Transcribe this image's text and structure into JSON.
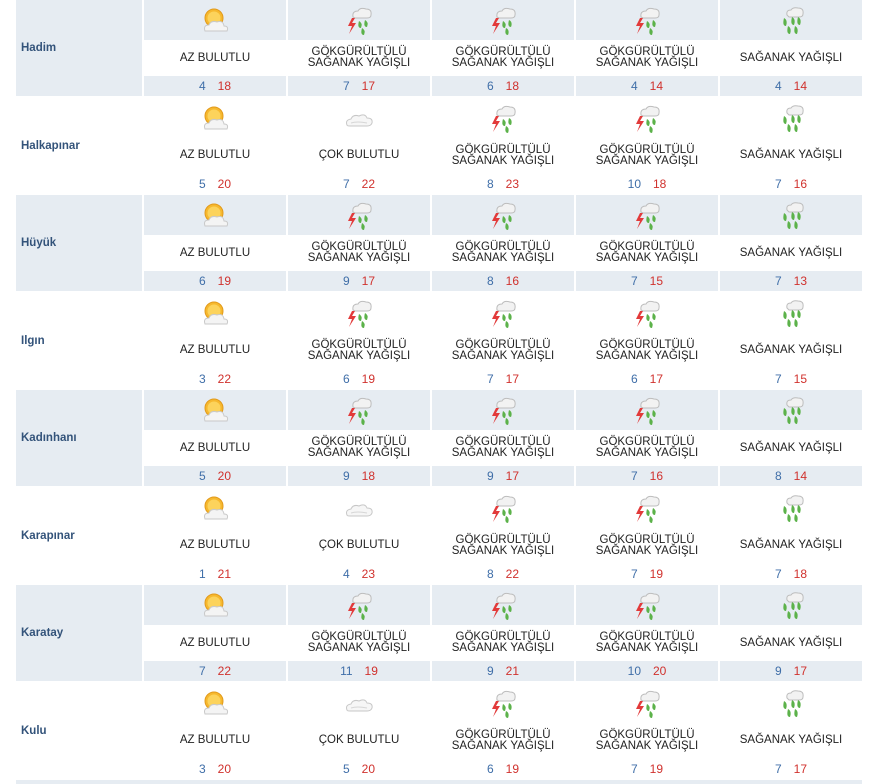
{
  "rows": [
    {
      "city": "Hadim",
      "days": [
        {
          "icon": "partly-cloudy-icon",
          "desc": "AZ BULUTLU",
          "min": "4",
          "max": "18"
        },
        {
          "icon": "thunder-rain-icon",
          "desc": "GÖKGÜRÜLTÜLÜ SAĞANAK YAĞIŞLI",
          "min": "7",
          "max": "17"
        },
        {
          "icon": "thunder-rain-icon",
          "desc": "GÖKGÜRÜLTÜLÜ SAĞANAK YAĞIŞLI",
          "min": "6",
          "max": "18"
        },
        {
          "icon": "thunder-rain-icon",
          "desc": "GÖKGÜRÜLTÜLÜ SAĞANAK YAĞIŞLI",
          "min": "4",
          "max": "14"
        },
        {
          "icon": "shower-rain-icon",
          "desc": "SAĞANAK YAĞIŞLI",
          "min": "4",
          "max": "14"
        }
      ]
    },
    {
      "city": "Halkapınar",
      "days": [
        {
          "icon": "partly-cloudy-icon",
          "desc": "AZ BULUTLU",
          "min": "5",
          "max": "20"
        },
        {
          "icon": "cloudy-icon",
          "desc": "ÇOK BULUTLU",
          "min": "7",
          "max": "22"
        },
        {
          "icon": "thunder-rain-icon",
          "desc": "GÖKGÜRÜLTÜLÜ SAĞANAK YAĞIŞLI",
          "min": "8",
          "max": "23"
        },
        {
          "icon": "thunder-rain-icon",
          "desc": "GÖKGÜRÜLTÜLÜ SAĞANAK YAĞIŞLI",
          "min": "10",
          "max": "18"
        },
        {
          "icon": "shower-rain-icon",
          "desc": "SAĞANAK YAĞIŞLI",
          "min": "7",
          "max": "16"
        }
      ]
    },
    {
      "city": "Hüyük",
      "days": [
        {
          "icon": "partly-cloudy-icon",
          "desc": "AZ BULUTLU",
          "min": "6",
          "max": "19"
        },
        {
          "icon": "thunder-rain-icon",
          "desc": "GÖKGÜRÜLTÜLÜ SAĞANAK YAĞIŞLI",
          "min": "9",
          "max": "17"
        },
        {
          "icon": "thunder-rain-icon",
          "desc": "GÖKGÜRÜLTÜLÜ SAĞANAK YAĞIŞLI",
          "min": "8",
          "max": "16"
        },
        {
          "icon": "thunder-rain-icon",
          "desc": "GÖKGÜRÜLTÜLÜ SAĞANAK YAĞIŞLI",
          "min": "7",
          "max": "15"
        },
        {
          "icon": "shower-rain-icon",
          "desc": "SAĞANAK YAĞIŞLI",
          "min": "7",
          "max": "13"
        }
      ]
    },
    {
      "city": "Ilgın",
      "days": [
        {
          "icon": "partly-cloudy-icon",
          "desc": "AZ BULUTLU",
          "min": "3",
          "max": "22"
        },
        {
          "icon": "thunder-rain-icon",
          "desc": "GÖKGÜRÜLTÜLÜ SAĞANAK YAĞIŞLI",
          "min": "6",
          "max": "19"
        },
        {
          "icon": "thunder-rain-icon",
          "desc": "GÖKGÜRÜLTÜLÜ SAĞANAK YAĞIŞLI",
          "min": "7",
          "max": "17"
        },
        {
          "icon": "thunder-rain-icon",
          "desc": "GÖKGÜRÜLTÜLÜ SAĞANAK YAĞIŞLI",
          "min": "6",
          "max": "17"
        },
        {
          "icon": "shower-rain-icon",
          "desc": "SAĞANAK YAĞIŞLI",
          "min": "7",
          "max": "15"
        }
      ]
    },
    {
      "city": "Kadınhanı",
      "days": [
        {
          "icon": "partly-cloudy-icon",
          "desc": "AZ BULUTLU",
          "min": "5",
          "max": "20"
        },
        {
          "icon": "thunder-rain-icon",
          "desc": "GÖKGÜRÜLTÜLÜ SAĞANAK YAĞIŞLI",
          "min": "9",
          "max": "18"
        },
        {
          "icon": "thunder-rain-icon",
          "desc": "GÖKGÜRÜLTÜLÜ SAĞANAK YAĞIŞLI",
          "min": "9",
          "max": "17"
        },
        {
          "icon": "thunder-rain-icon",
          "desc": "GÖKGÜRÜLTÜLÜ SAĞANAK YAĞIŞLI",
          "min": "7",
          "max": "16"
        },
        {
          "icon": "shower-rain-icon",
          "desc": "SAĞANAK YAĞIŞLI",
          "min": "8",
          "max": "14"
        }
      ]
    },
    {
      "city": "Karapınar",
      "days": [
        {
          "icon": "partly-cloudy-icon",
          "desc": "AZ BULUTLU",
          "min": "1",
          "max": "21"
        },
        {
          "icon": "cloudy-icon",
          "desc": "ÇOK BULUTLU",
          "min": "4",
          "max": "23"
        },
        {
          "icon": "thunder-rain-icon",
          "desc": "GÖKGÜRÜLTÜLÜ SAĞANAK YAĞIŞLI",
          "min": "8",
          "max": "22"
        },
        {
          "icon": "thunder-rain-icon",
          "desc": "GÖKGÜRÜLTÜLÜ SAĞANAK YAĞIŞLI",
          "min": "7",
          "max": "19"
        },
        {
          "icon": "shower-rain-icon",
          "desc": "SAĞANAK YAĞIŞLI",
          "min": "7",
          "max": "18"
        }
      ]
    },
    {
      "city": "Karatay",
      "days": [
        {
          "icon": "partly-cloudy-icon",
          "desc": "AZ BULUTLU",
          "min": "7",
          "max": "22"
        },
        {
          "icon": "thunder-rain-icon",
          "desc": "GÖKGÜRÜLTÜLÜ SAĞANAK YAĞIŞLI",
          "min": "11",
          "max": "19"
        },
        {
          "icon": "thunder-rain-icon",
          "desc": "GÖKGÜRÜLTÜLÜ SAĞANAK YAĞIŞLI",
          "min": "9",
          "max": "21"
        },
        {
          "icon": "thunder-rain-icon",
          "desc": "GÖKGÜRÜLTÜLÜ SAĞANAK YAĞIŞLI",
          "min": "10",
          "max": "20"
        },
        {
          "icon": "shower-rain-icon",
          "desc": "SAĞANAK YAĞIŞLI",
          "min": "9",
          "max": "17"
        }
      ]
    },
    {
      "city": "Kulu",
      "days": [
        {
          "icon": "partly-cloudy-icon",
          "desc": "AZ BULUTLU",
          "min": "3",
          "max": "20"
        },
        {
          "icon": "cloudy-icon",
          "desc": "ÇOK BULUTLU",
          "min": "5",
          "max": "20"
        },
        {
          "icon": "thunder-rain-icon",
          "desc": "GÖKGÜRÜLTÜLÜ SAĞANAK YAĞIŞLI",
          "min": "6",
          "max": "19"
        },
        {
          "icon": "thunder-rain-icon",
          "desc": "GÖKGÜRÜLTÜLÜ SAĞANAK YAĞIŞLI",
          "min": "7",
          "max": "19"
        },
        {
          "icon": "shower-rain-icon",
          "desc": "SAĞANAK YAĞIŞLI",
          "min": "7",
          "max": "17"
        }
      ]
    }
  ],
  "colors": {
    "shaded_row": "#e6ecf2",
    "city_text": "#33537a",
    "min_temp": "#3f6ea8",
    "max_temp": "#d0312d"
  }
}
